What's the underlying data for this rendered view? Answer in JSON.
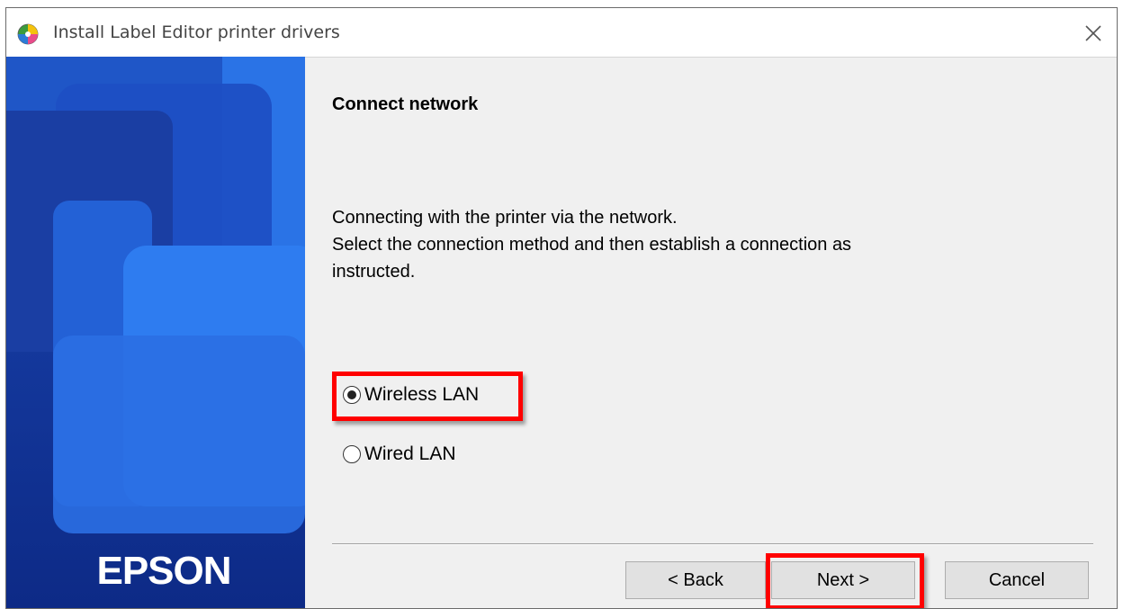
{
  "window": {
    "title": "Install Label Editor printer drivers"
  },
  "branding": {
    "logo_text": "EPSON"
  },
  "content": {
    "heading": "Connect network",
    "description_lines": [
      "Connecting with the printer via the network.",
      "Select the connection method and then establish a connection as",
      "instructed."
    ]
  },
  "options": [
    {
      "label": "Wireless LAN",
      "selected": true
    },
    {
      "label": "Wired LAN",
      "selected": false
    }
  ],
  "buttons": {
    "back": "< Back",
    "next": "Next >",
    "cancel": "Cancel"
  },
  "annotations": {
    "highlight_color": "#ff0000"
  },
  "icons": {
    "app": "app-logo-icon",
    "close": "close-icon"
  }
}
